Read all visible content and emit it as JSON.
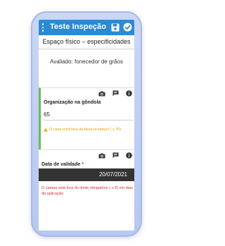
{
  "app": {
    "title": "Teste Inspeção",
    "brand_color": "#2a8bd4"
  },
  "section": {
    "title": "Espaço físico – especificidades"
  },
  "evaluated": {
    "text": "Avaliado:  fonecedor de grãos"
  },
  "fields": [
    {
      "label": "Organização na gôndola",
      "value": "65",
      "warning": "O valor está fora da faixa aceitável ( ≤ 75).",
      "status_color": "#6dbb4f",
      "icons": [
        "camera-icon",
        "comment-icon",
        "info-icon"
      ]
    },
    {
      "label": "Data de validade",
      "required_mark": "*",
      "value": "20/07/2021",
      "error": "O campo está fora do limite obrigatório ( ≤ 5) em dias da aplicação",
      "icons": [
        "camera-icon",
        "comment-icon",
        "info-icon"
      ]
    }
  ]
}
